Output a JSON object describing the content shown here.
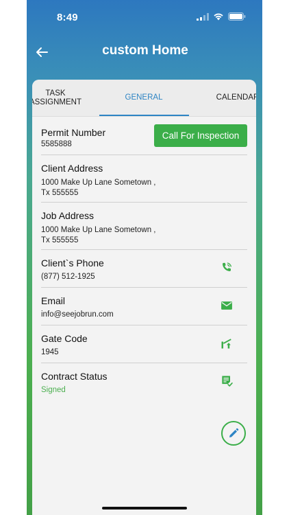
{
  "status_bar": {
    "time": "8:49"
  },
  "header": {
    "title": "custom Home"
  },
  "tabs": [
    {
      "label": "TASK ASSIGNMENT",
      "line1": "TASK",
      "line2": "ASSIGNMENT"
    },
    {
      "label": "GENERAL"
    },
    {
      "label": "CALENDAR"
    }
  ],
  "active_tab": "GENERAL",
  "permit": {
    "label": "Permit Number",
    "value": "5585888",
    "action_label": "Call For Inspection"
  },
  "client_address": {
    "label": "Client Address",
    "line1": "1000 Make Up Lane Sometown ,",
    "line2": "Tx 555555"
  },
  "job_address": {
    "label": "Job Address",
    "line1": "1000 Make Up Lane Sometown ,",
    "line2": "Tx 555555"
  },
  "client_phone": {
    "label": "Client`s Phone",
    "value": "(877) 512-1925",
    "icon": "phone-call-icon"
  },
  "email": {
    "label": "Email",
    "value": "info@seejobrun.com",
    "icon": "envelope-icon"
  },
  "gate_code": {
    "label": "Gate Code",
    "value": "1945",
    "icon": "gate-icon"
  },
  "contract_status": {
    "label": "Contract Status",
    "value": "Signed",
    "icon": "document-check-icon"
  },
  "fab": {
    "icon": "pencil-edit-icon"
  },
  "colors": {
    "accent_green": "#3bae49",
    "tab_blue": "#2d84c4",
    "header_blue": "#2d78bf"
  }
}
